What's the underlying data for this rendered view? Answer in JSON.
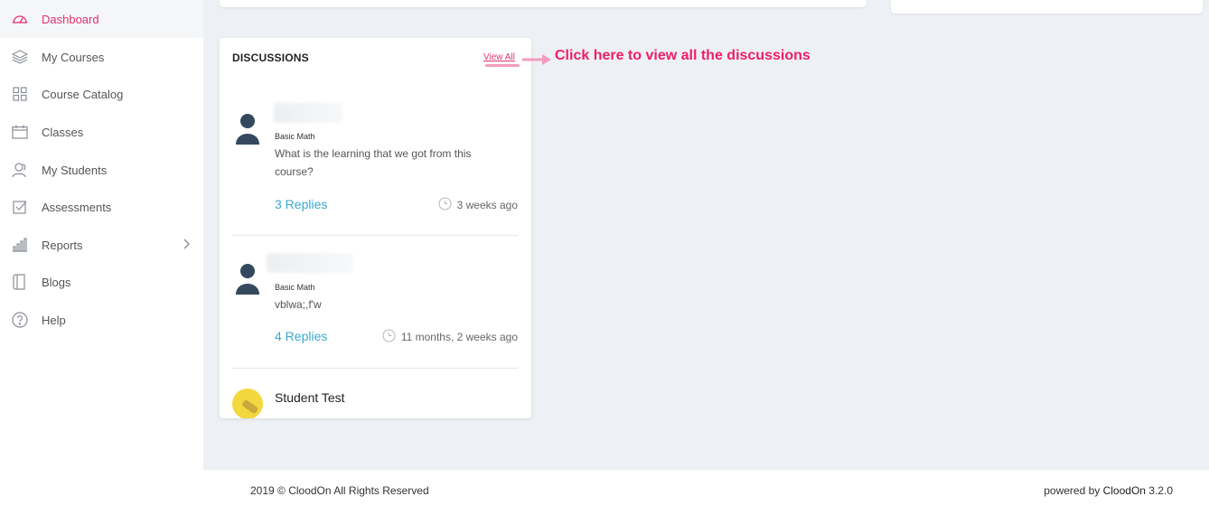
{
  "sidebar": {
    "items": [
      {
        "label": "Dashboard",
        "icon": "dashboard-icon"
      },
      {
        "label": "My Courses",
        "icon": "layers-icon"
      },
      {
        "label": "Course Catalog",
        "icon": "grid-icon"
      },
      {
        "label": "Classes",
        "icon": "calendar-icon"
      },
      {
        "label": "My Students",
        "icon": "users-icon"
      },
      {
        "label": "Assessments",
        "icon": "checkbox-icon"
      },
      {
        "label": "Reports",
        "icon": "bar-chart-icon"
      },
      {
        "label": "Blogs",
        "icon": "book-icon"
      },
      {
        "label": "Help",
        "icon": "help-circle-icon"
      }
    ],
    "active_index": 0
  },
  "discussions": {
    "title": "DISCUSSIONS",
    "view_all": "View All",
    "posts": [
      {
        "course": "Basic Math",
        "text": "What is the learning that we got from this course?",
        "replies": "3 Replies",
        "time": "3 weeks ago"
      },
      {
        "course": "Basic Math",
        "text": "vblwa;,f'w",
        "replies": "4 Replies",
        "time": "11 months, 2 weeks ago"
      }
    ],
    "next_author": "Student Test"
  },
  "annotation": {
    "text": "Click here to view all the discussions",
    "color": "#ee1f66"
  },
  "footer": {
    "copyright": "2019 © CloodOn All Rights Reserved",
    "powered_prefix": "powered by ",
    "powered_brand": "CloodOn",
    "powered_version": " 3.2.0"
  },
  "colors": {
    "accent": "#e5336f",
    "link": "#3aa9cc",
    "background": "#edf0f4"
  }
}
